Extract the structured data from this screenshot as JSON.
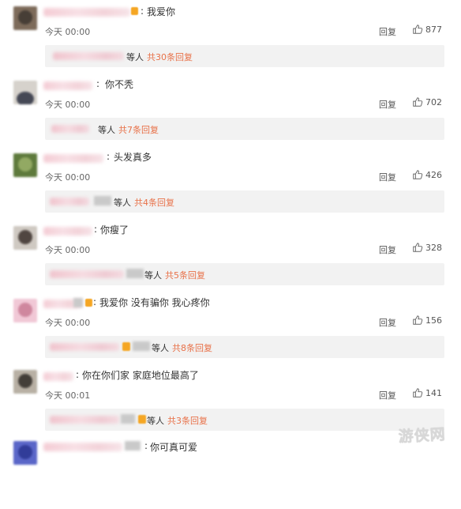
{
  "comments": [
    {
      "text": "我爱你",
      "time": "今天 00:00",
      "reply": "回复",
      "likes": "877",
      "sub_deng": "等人",
      "sub_total": "共30条回复",
      "avatar_colors": [
        "#7d6b5a",
        "#3d3630"
      ]
    },
    {
      "text": "你不秃",
      "time": "今天 00:00",
      "reply": "回复",
      "likes": "702",
      "sub_deng": "等人",
      "sub_total": "共7条回复",
      "avatar_colors": [
        "#d6d2cc",
        "#2c3040"
      ]
    },
    {
      "text": "头发真多",
      "time": "今天 00:00",
      "reply": "回复",
      "likes": "426",
      "sub_deng": "等人",
      "sub_total": "共4条回复",
      "avatar_colors": [
        "#5e7a3c",
        "#9bb26a"
      ]
    },
    {
      "text": "你瘦了",
      "time": "今天 00:00",
      "reply": "回复",
      "likes": "328",
      "sub_deng": "等人",
      "sub_total": "共5条回复",
      "avatar_colors": [
        "#cfc9c2",
        "#3a2f2a"
      ]
    },
    {
      "text": "我爱你 没有骗你 我心疼你",
      "time": "今天 00:00",
      "reply": "回复",
      "likes": "156",
      "sub_deng": "等人",
      "sub_total": "共8条回复",
      "avatar_colors": [
        "#f1c8d6",
        "#c97b94"
      ]
    },
    {
      "text": "你在你们家 家庭地位最高了",
      "time": "今天 00:01",
      "reply": "回复",
      "likes": "141",
      "sub_deng": "等人",
      "sub_total": "共3条回复",
      "avatar_colors": [
        "#b8b0a4",
        "#2e2a26"
      ]
    },
    {
      "text": "你可真可爱",
      "time": "",
      "reply": "",
      "likes": "",
      "sub_deng": "",
      "sub_total": "",
      "avatar_colors": [
        "#5a66c8",
        "#2a3590"
      ]
    }
  ],
  "watermark": {
    "text": "游侠网",
    "url": "ALI213.NET"
  },
  "colors": {
    "accent": "#e87149",
    "sub_bg": "#f2f2f2"
  }
}
